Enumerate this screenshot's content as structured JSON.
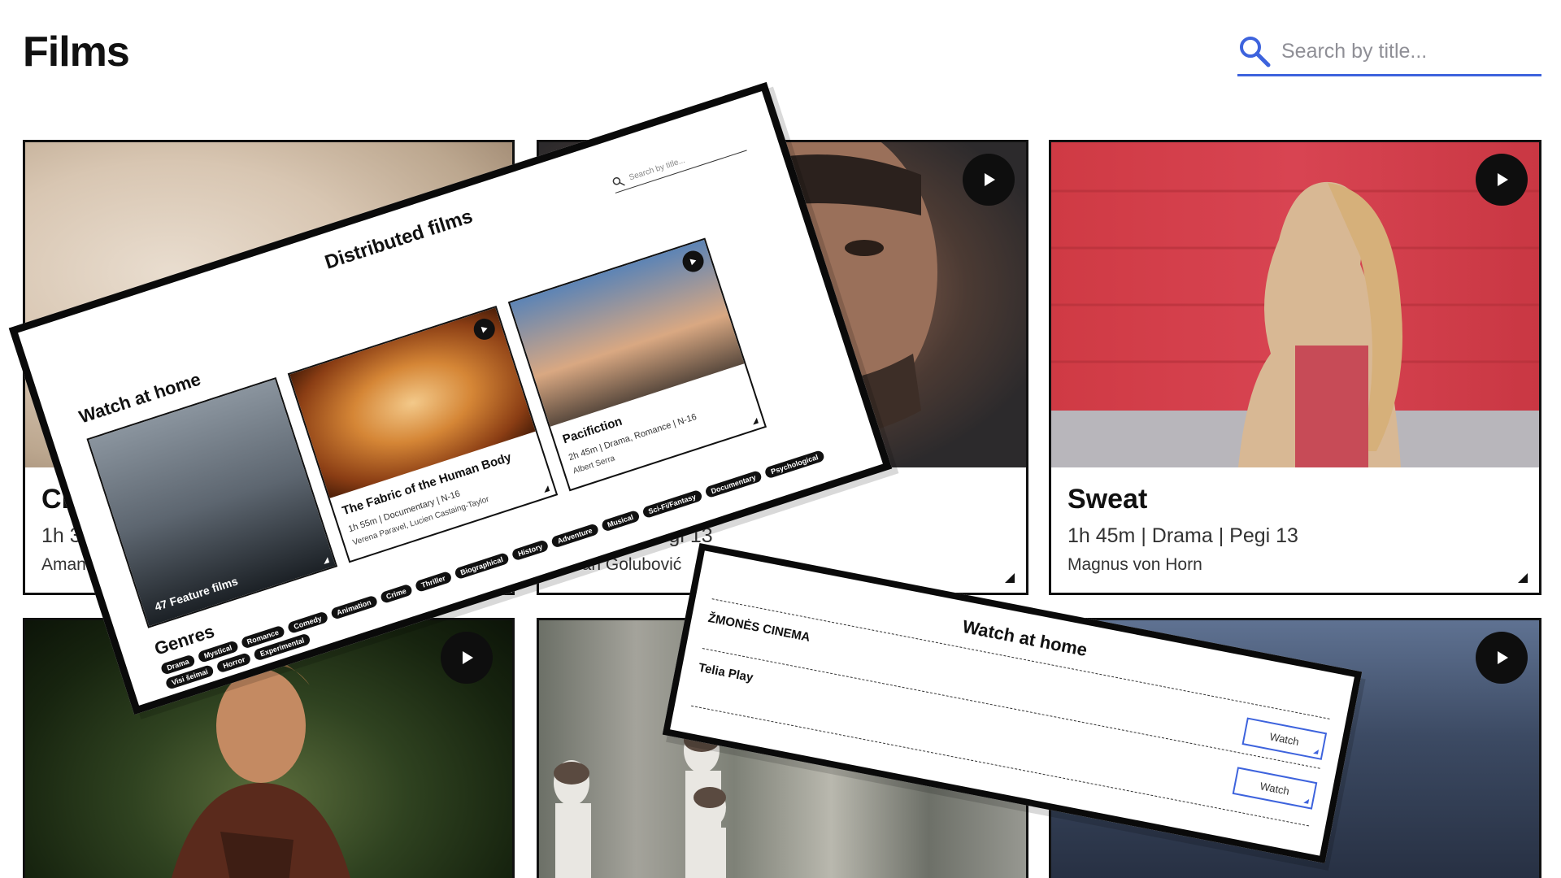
{
  "header": {
    "title": "Films",
    "search_placeholder": "Search by title..."
  },
  "cards": [
    {
      "title": "Char",
      "meta": "1h 34m",
      "director": "Amanda K"
    },
    {
      "title": "",
      "meta": "| Drama | Pegi 13",
      "director": "Srdan Golubović"
    },
    {
      "title": "Sweat",
      "meta": "1h 45m | Drama | Pegi 13",
      "director": "Magnus von Horn"
    }
  ],
  "overlay_distributed": {
    "title": "Distributed films",
    "search_placeholder": "Search by title...",
    "section": "Watch at home",
    "featured_caption": "47 Feature films",
    "films": [
      {
        "title": "The Fabric of the Human Body",
        "meta": "1h 55m | Documentary | N-16",
        "director": "Verena Paravel, Lucien Castaing-Taylor"
      },
      {
        "title": "Pacifiction",
        "meta": "2h 45m | Drama, Romance | N-16",
        "director": "Albert Serra"
      }
    ],
    "genres_label": "Genres",
    "genres": [
      "Drama",
      "Mystical",
      "Romance",
      "Comedy",
      "Animation",
      "Crime",
      "Thriller",
      "Biographical",
      "History",
      "Adventure",
      "Musical",
      "Sci-Fi/Fantasy",
      "Documentary",
      "Psychological",
      "Visi šeimai",
      "Horror",
      "Experimental"
    ]
  },
  "overlay_watch": {
    "title": "Watch at home",
    "providers": [
      {
        "name": "ŽMONĖS CINEMA",
        "button": "Watch"
      },
      {
        "name": "Telia Play",
        "button": "Watch"
      }
    ]
  },
  "colors": {
    "accent": "#3d63dd",
    "ink": "#111111"
  },
  "icons": {
    "search": "search-icon",
    "play": "play-icon"
  }
}
